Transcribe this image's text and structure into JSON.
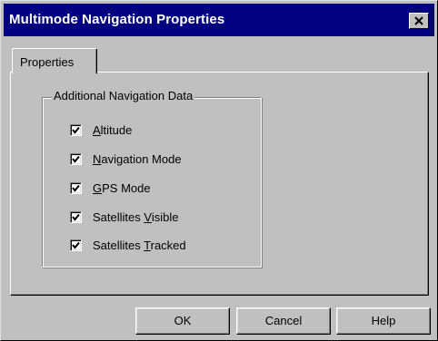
{
  "window": {
    "title": "Multimode Navigation Properties"
  },
  "tabs": [
    {
      "label": "Properties",
      "selected": true
    }
  ],
  "group": {
    "label": "Additional Navigation Data",
    "items": [
      {
        "pre": "",
        "key": "A",
        "post": "ltitude",
        "checked": true
      },
      {
        "pre": "",
        "key": "N",
        "post": "avigation Mode",
        "checked": true
      },
      {
        "pre": "",
        "key": "G",
        "post": "PS Mode",
        "checked": true
      },
      {
        "pre": "Satellites ",
        "key": "V",
        "post": "isible",
        "checked": true
      },
      {
        "pre": "Satellites ",
        "key": "T",
        "post": "racked",
        "checked": true
      }
    ]
  },
  "buttons": {
    "ok": "OK",
    "cancel": "Cancel",
    "help": "Help"
  }
}
